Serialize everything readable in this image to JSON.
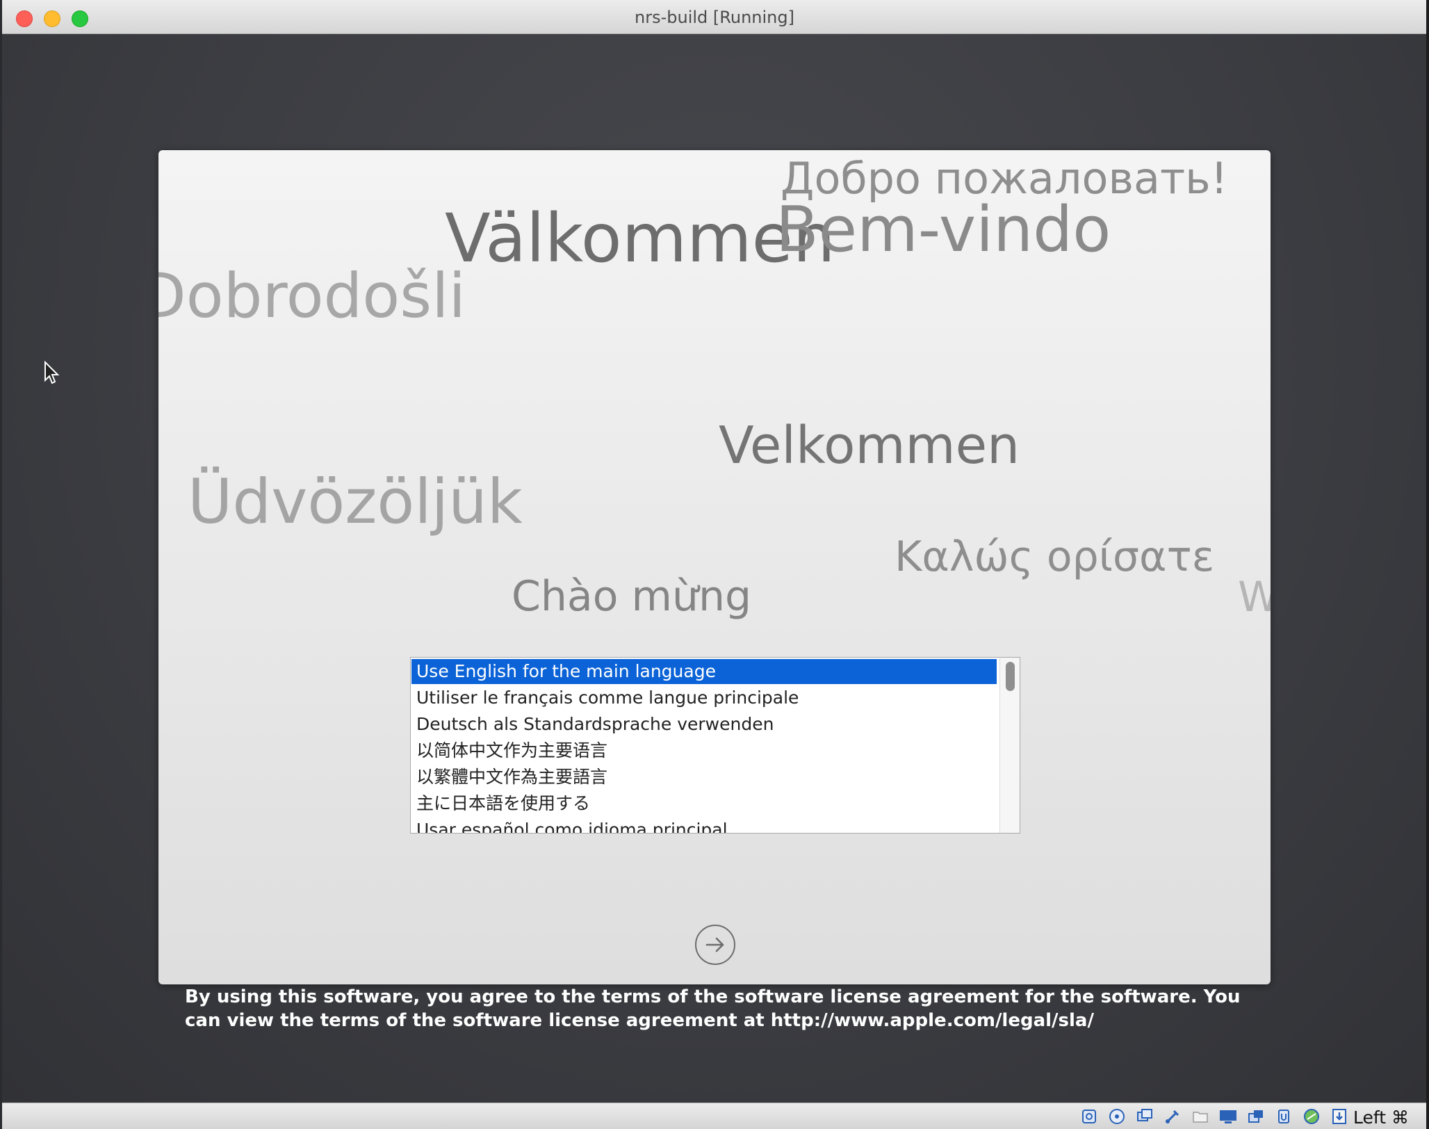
{
  "window": {
    "title": "nrs-build [Running]"
  },
  "greetings": [
    {
      "text": "Добро пожаловать!",
      "color": "#8e8e8e"
    },
    {
      "text": "Välkommen",
      "color": "#6d6d6d"
    },
    {
      "text": "Bem-vindo",
      "color": "#8a8a8a"
    },
    {
      "text": "Dobrodošli",
      "color": "#a7a7a7"
    },
    {
      "text": "Velkommen",
      "color": "#747474"
    },
    {
      "text": "Üdvözöljük",
      "color": "#a4a4a4"
    },
    {
      "text": "Καλώς ορίσατε",
      "color": "#8e8e8e"
    },
    {
      "text": "Chào mừng",
      "color": "#858585"
    },
    {
      "text": "W",
      "color": "#b5b5b5"
    }
  ],
  "language_list": {
    "items": [
      "Use English for the main language",
      "Utiliser le français comme langue principale",
      "Deutsch als Standardsprache verwenden",
      "以简体中文作为主要语言",
      "以繁體中文作為主要語言",
      "主に日本語を使用する",
      "Usar español como idioma principal"
    ],
    "selected_index": 0
  },
  "next_button": {
    "icon": "arrow-right-circle-icon"
  },
  "license_text": "By using this software, you agree to the terms of the software license agreement for the software. You can view the terms of the software license agreement at http://www.apple.com/legal/sla/",
  "statusbar": {
    "icons": [
      "hard-disk-icon",
      "optical-drive-icon",
      "audio-icon",
      "usb-icon",
      "shared-folder-icon",
      "display-icon",
      "video-capture-icon",
      "cpu-icon",
      "network-icon",
      "mouse-integration-icon"
    ],
    "host_key": "Left ⌘"
  },
  "colors": {
    "selection": "#0b63d7",
    "screen_bg": "#3c3d42"
  }
}
